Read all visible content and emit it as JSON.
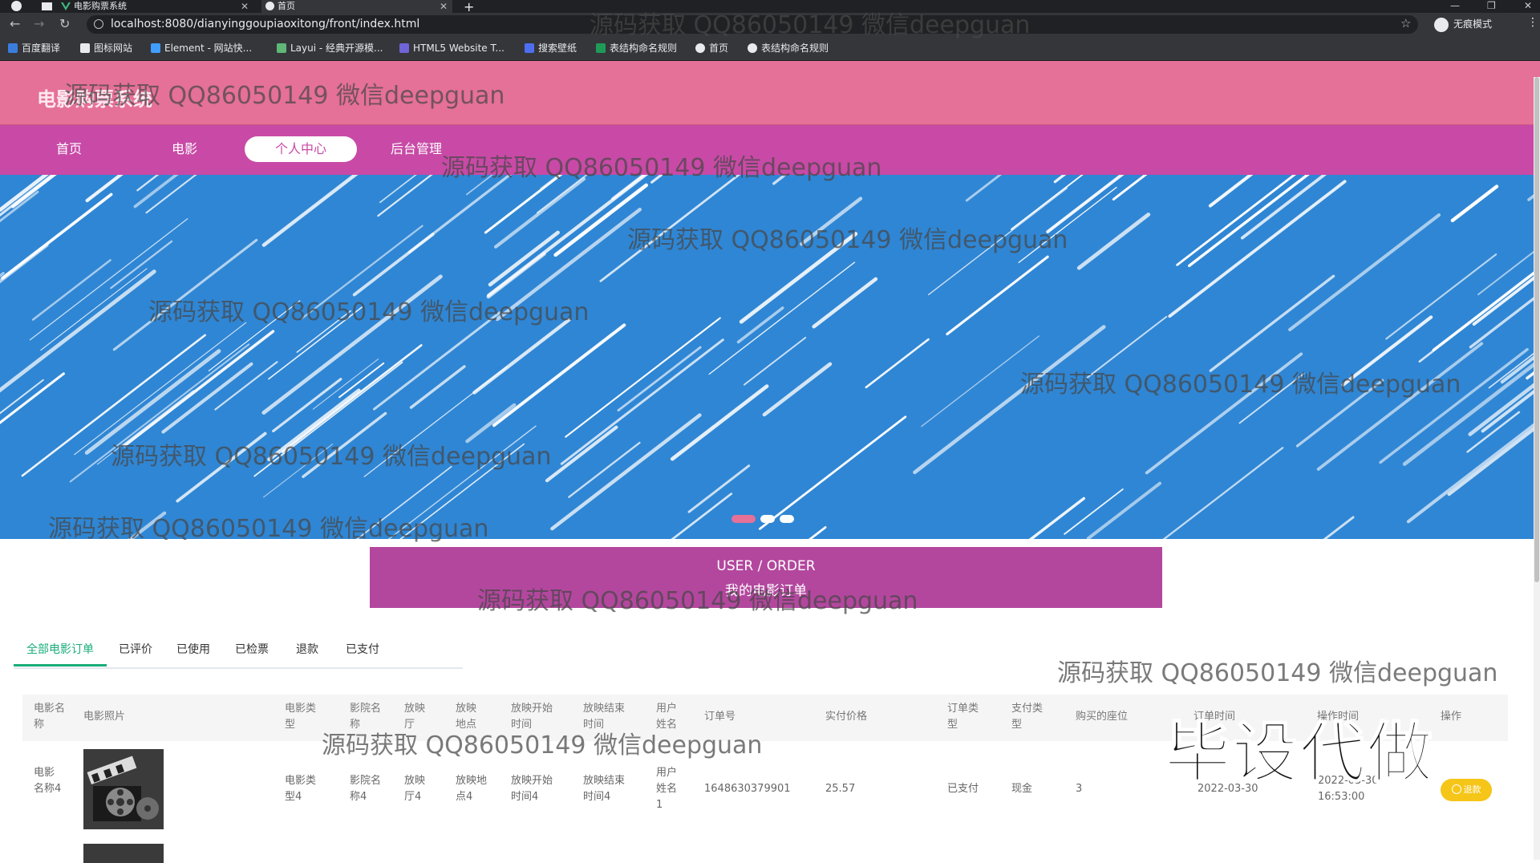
{
  "browser": {
    "tabs": [
      {
        "title": "电影购票系统",
        "active": false
      },
      {
        "title": "首页",
        "active": true
      }
    ],
    "url": "localhost:8080/dianyinggoupiaoxitong/front/index.html",
    "profile_label": "无痕模式",
    "bookmarks": [
      "百度翻译",
      "图标网站",
      "Element - 网站快...",
      "Layui - 经典开源模...",
      "HTML5 Website T...",
      "搜索壁纸",
      "表结构命名规则",
      "首页",
      "表结构命名规则"
    ]
  },
  "site": {
    "title": "电影购票系统",
    "nav": [
      "首页",
      "电影",
      "个人中心",
      "后台管理"
    ],
    "active_nav": "个人中心"
  },
  "section": {
    "title_en": "USER / ORDER",
    "title_cn": "我的电影订单"
  },
  "order_tabs": [
    "全部电影订单",
    "已评价",
    "已使用",
    "已检票",
    "退款",
    "已支付"
  ],
  "active_order_tab": "全部电影订单",
  "table": {
    "headers": [
      "电影名称",
      "电影照片",
      "电影类型",
      "影院名称",
      "放映厅",
      "放映地点",
      "放映开始时间",
      "放映结束时间",
      "用户姓名",
      "订单号",
      "实付价格",
      "订单类型",
      "支付类型",
      "购买的座位",
      "订单时间",
      "操作时间",
      "操作"
    ],
    "rows": [
      {
        "movie_name": "电影名称4",
        "movie_type": "电影类型4",
        "cinema_name": "影院名称4",
        "hall": "放映厅4",
        "location": "放映地点4",
        "start_time": "放映开始时间4",
        "end_time": "放映结束时间4",
        "user_name": "用户姓名1",
        "order_no": "1648630379901",
        "price": "25.57",
        "order_type": "已支付",
        "pay_type": "现金",
        "seats": "3",
        "order_date": "2022-03-30",
        "op_time": "2022-03-30 16:53:00",
        "action": "退款"
      }
    ]
  },
  "watermark": "源码获取 QQ86050149 微信deepguan",
  "stamp": "毕设代做",
  "colors": {
    "header": "#e57098",
    "nav": "#c84aa6",
    "banner": "#2f86d4",
    "section": "#b3479e",
    "tab_active": "#1aad7a",
    "refund": "#f5c518"
  }
}
